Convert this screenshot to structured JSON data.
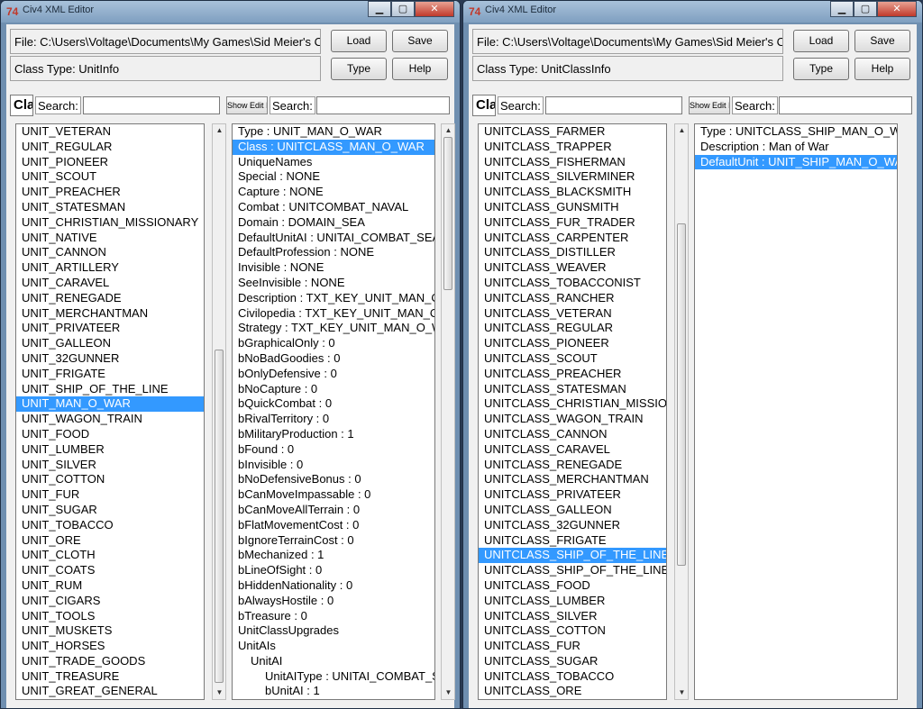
{
  "left_window": {
    "title": "Civ4 XML Editor",
    "file_label": "File: C:\\Users\\Voltage\\Documents\\My Games\\Sid Meier's Civi",
    "class_type_label": "Class Type: UnitInfo",
    "buttons": {
      "load": "Load",
      "save": "Save",
      "type": "Type",
      "help": "Help"
    },
    "class_label": "Class",
    "search_label": "Search:",
    "search2_label": "Search:",
    "show_edit_label": "Show Edit I",
    "list_items": [
      "UNIT_VETERAN",
      "UNIT_REGULAR",
      "UNIT_PIONEER",
      "UNIT_SCOUT",
      "UNIT_PREACHER",
      "UNIT_STATESMAN",
      "UNIT_CHRISTIAN_MISSIONARY",
      "UNIT_NATIVE",
      "UNIT_CANNON",
      "UNIT_ARTILLERY",
      "UNIT_CARAVEL",
      "UNIT_RENEGADE",
      "UNIT_MERCHANTMAN",
      "UNIT_PRIVATEER",
      "UNIT_GALLEON",
      "UNIT_32GUNNER",
      "UNIT_FRIGATE",
      "UNIT_SHIP_OF_THE_LINE",
      "UNIT_MAN_O_WAR",
      "UNIT_WAGON_TRAIN",
      "UNIT_FOOD",
      "UNIT_LUMBER",
      "UNIT_SILVER",
      "UNIT_COTTON",
      "UNIT_FUR",
      "UNIT_SUGAR",
      "UNIT_TOBACCO",
      "UNIT_ORE",
      "UNIT_CLOTH",
      "UNIT_COATS",
      "UNIT_RUM",
      "UNIT_CIGARS",
      "UNIT_TOOLS",
      "UNIT_MUSKETS",
      "UNIT_HORSES",
      "UNIT_TRADE_GOODS",
      "UNIT_TREASURE",
      "UNIT_GREAT_GENERAL"
    ],
    "attrs": [
      "Type :  UNIT_MAN_O_WAR",
      "Class :  UNITCLASS_MAN_O_WAR",
      "UniqueNames",
      "Special :  NONE",
      "Capture :  NONE",
      "Combat :  UNITCOMBAT_NAVAL",
      "Domain :  DOMAIN_SEA",
      "DefaultUnitAI :  UNITAI_COMBAT_SEA",
      "DefaultProfession :  NONE",
      "Invisible :  NONE",
      "SeeInvisible :  NONE",
      "Description :  TXT_KEY_UNIT_MAN_O",
      "Civilopedia :  TXT_KEY_UNIT_MAN_O",
      "Strategy :  TXT_KEY_UNIT_MAN_O_W",
      "bGraphicalOnly :  0",
      "bNoBadGoodies :  0",
      "bOnlyDefensive :  0",
      "bNoCapture :  0",
      "bQuickCombat :  0",
      "bRivalTerritory :  0",
      "bMilitaryProduction :  1",
      "bFound :  0",
      "bInvisible :  0",
      "bNoDefensiveBonus :  0",
      "bCanMoveImpassable :  0",
      "bCanMoveAllTerrain :  0",
      "bFlatMovementCost :  0",
      "bIgnoreTerrainCost :  0",
      "bMechanized :  1",
      "bLineOfSight :  0",
      "bHiddenNationality :  0",
      "bAlwaysHostile :  0",
      "bTreasure :  0",
      "UnitClassUpgrades",
      "UnitAIs",
      "UnitAI",
      "UnitAIType :  UNITAI_COMBAT_S",
      "bUnitAI :  1"
    ]
  },
  "right_window": {
    "title": "Civ4 XML Editor",
    "file_label": "File: C:\\Users\\Voltage\\Documents\\My Games\\Sid Meier's Civi",
    "class_type_label": "Class Type: UnitClassInfo",
    "buttons": {
      "load": "Load",
      "save": "Save",
      "type": "Type",
      "help": "Help"
    },
    "class_label": "Class",
    "search_label": "Search:",
    "search2_label": "Search:",
    "show_edit_label": "Show Edit I",
    "list_items": [
      "UNITCLASS_FARMER",
      "UNITCLASS_TRAPPER",
      "UNITCLASS_FISHERMAN",
      "UNITCLASS_SILVERMINER",
      "UNITCLASS_BLACKSMITH",
      "UNITCLASS_GUNSMITH",
      "UNITCLASS_FUR_TRADER",
      "UNITCLASS_CARPENTER",
      "UNITCLASS_DISTILLER",
      "UNITCLASS_WEAVER",
      "UNITCLASS_TOBACCONIST",
      "UNITCLASS_RANCHER",
      "UNITCLASS_VETERAN",
      "UNITCLASS_REGULAR",
      "UNITCLASS_PIONEER",
      "UNITCLASS_SCOUT",
      "UNITCLASS_PREACHER",
      "UNITCLASS_STATESMAN",
      "UNITCLASS_CHRISTIAN_MISSION",
      "UNITCLASS_WAGON_TRAIN",
      "UNITCLASS_CANNON",
      "UNITCLASS_CARAVEL",
      "UNITCLASS_RENEGADE",
      "UNITCLASS_MERCHANTMAN",
      "UNITCLASS_PRIVATEER",
      "UNITCLASS_GALLEON",
      "UNITCLASS_32GUNNER",
      "UNITCLASS_FRIGATE",
      "UNITCLASS_SHIP_OF_THE_LINE",
      "UNITCLASS_SHIP_OF_THE_LINE",
      "UNITCLASS_FOOD",
      "UNITCLASS_LUMBER",
      "UNITCLASS_SILVER",
      "UNITCLASS_COTTON",
      "UNITCLASS_FUR",
      "UNITCLASS_SUGAR",
      "UNITCLASS_TOBACCO",
      "UNITCLASS_ORE"
    ],
    "attrs": [
      "Type :  UNITCLASS_SHIP_MAN_O_W",
      "Description :  Man of War",
      "DefaultUnit :  UNIT_SHIP_MAN_O_WA"
    ]
  },
  "colors": {
    "selection": "#3399ff",
    "titlebar": "#7f9fc0",
    "close": "#c0392b"
  }
}
